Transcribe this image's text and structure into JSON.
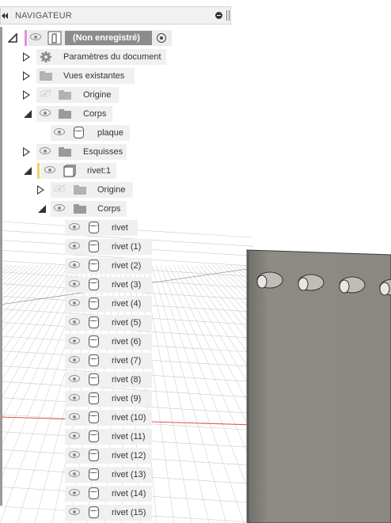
{
  "navigator": {
    "title": "NAVIGATEUR",
    "root_label": "(Non enregistré)",
    "items": {
      "document_settings": "Paramètres du document",
      "named_views": "Vues existantes",
      "origin": "Origine",
      "bodies": "Corps",
      "plate": "plaque",
      "sketches": "Esquisses",
      "component": "rivet:1",
      "comp_origin": "Origine",
      "comp_bodies": "Corps"
    },
    "rivets": [
      "rivet",
      "rivet (1)",
      "rivet (2)",
      "rivet (3)",
      "rivet (4)",
      "rivet (5)",
      "rivet (6)",
      "rivet (7)",
      "rivet (8)",
      "rivet (9)",
      "rivet (10)",
      "rivet (11)",
      "rivet (12)",
      "rivet (13)",
      "rivet (14)",
      "rivet (15)"
    ]
  },
  "colors": {
    "root_marker": "#e58ee0",
    "component_marker": "#f2cf6d",
    "root_highlight": "#8c8c8c",
    "x_axis": "#e05050",
    "plate": "#8b8982"
  },
  "icons": {
    "collapse": "double-left-arrow-icon",
    "pin": "pin-icon",
    "visibility": "eye-icon",
    "folder": "folder-icon",
    "body": "body-cylinder-icon",
    "settings": "gear-icon",
    "active": "radio-dot-icon"
  }
}
